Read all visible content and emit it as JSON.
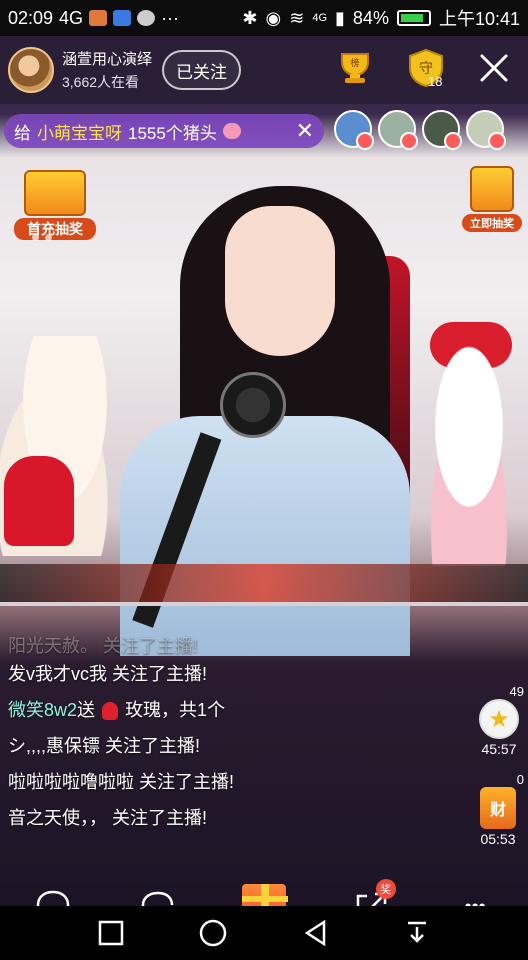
{
  "status_bar": {
    "time": "02:09",
    "network_left": "4G",
    "network_right": "4G",
    "battery": "84%",
    "clock": "上午10:41"
  },
  "header": {
    "streamer_name": "涵萱用心演绎",
    "viewer_count": "3,662人在看",
    "follow_label": "已关注",
    "rank_label": "榜",
    "guard_label": "守",
    "guard_count": "18"
  },
  "gift_banner": {
    "prefix": "给",
    "sender": "小萌宝宝呀",
    "gift_text": "1555个猪头"
  },
  "promos": {
    "left_label": "首充抽奖",
    "right_label": "立即抽奖"
  },
  "chat": {
    "faded_line": "阳光天赦。 关注了主播!",
    "messages": [
      {
        "user": "",
        "text": "发v我才vc我 关注了主播!"
      },
      {
        "user": "微笑8w2",
        "text_before": "送",
        "gift": "玫瑰，共1个"
      },
      {
        "user": "",
        "text": "シ,,,,惠保镖 关注了主播!"
      },
      {
        "user": "",
        "text": "啦啦啦啦噜啦啦 关注了主播!"
      },
      {
        "user": "",
        "text": "音之天使，， 关注了主播!"
      }
    ]
  },
  "widgets": {
    "star_count": "49",
    "star_timer": "45:57",
    "fortune_count": "0",
    "fortune_label": "财",
    "fortune_timer": "05:53"
  },
  "toolbar": {
    "private_label": "私",
    "reward_badge": "奖",
    "more_label": "•••"
  },
  "colors": {
    "accent_purple": "#7d46be",
    "chat_username": "#8ff3d8",
    "gift_sender": "#ffe14a"
  }
}
